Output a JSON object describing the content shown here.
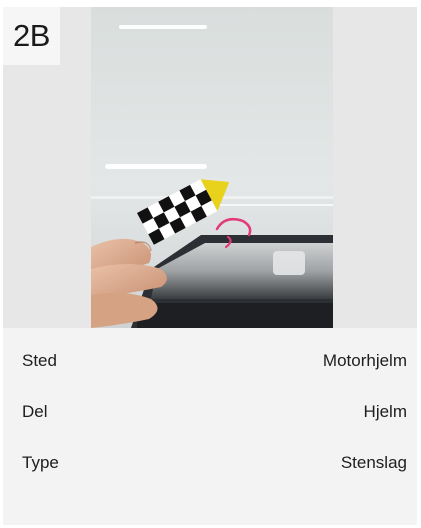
{
  "card": {
    "badge": "2B",
    "photo": {
      "subject": "stone chip damage on car hood with checkered measurement marker"
    },
    "details": [
      {
        "label": "Sted",
        "value": "Motorhjelm"
      },
      {
        "label": "Del",
        "value": "Hjelm"
      },
      {
        "label": "Type",
        "value": "Stenslag"
      }
    ]
  }
}
